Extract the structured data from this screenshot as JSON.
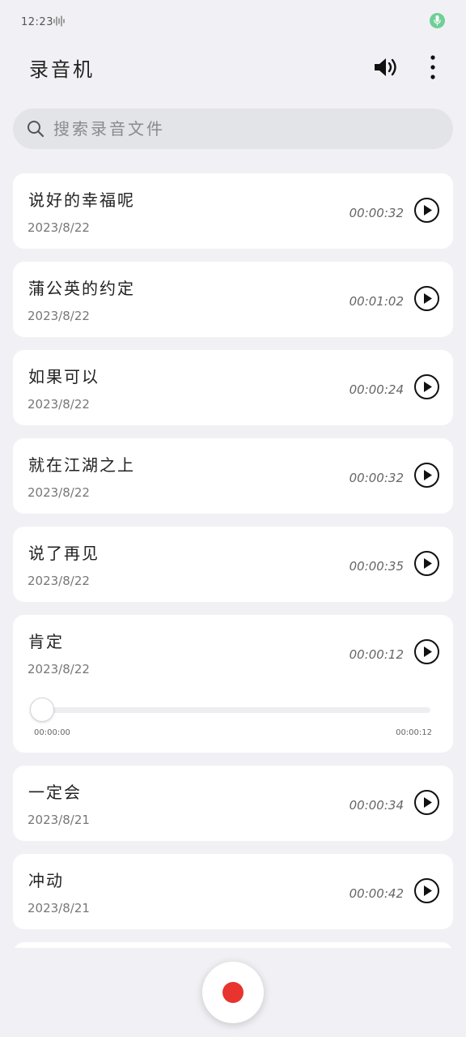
{
  "status_bar": {
    "time": "12:23"
  },
  "header": {
    "title": "录音机"
  },
  "search": {
    "placeholder": "搜索录音文件"
  },
  "recordings": [
    {
      "title": "说好的幸福呢",
      "date": "2023/8/22",
      "duration": "00:00:32"
    },
    {
      "title": "蒲公英的约定",
      "date": "2023/8/22",
      "duration": "00:01:02"
    },
    {
      "title": "如果可以",
      "date": "2023/8/22",
      "duration": "00:00:24"
    },
    {
      "title": "就在江湖之上",
      "date": "2023/8/22",
      "duration": "00:00:32"
    },
    {
      "title": "说了再见",
      "date": "2023/8/22",
      "duration": "00:00:35"
    },
    {
      "title": "肯定",
      "date": "2023/8/22",
      "duration": "00:00:12",
      "playback": {
        "current": "00:00:00",
        "total": "00:00:12",
        "progress": 0
      }
    },
    {
      "title": "一定会",
      "date": "2023/8/21",
      "duration": "00:00:34"
    },
    {
      "title": "冲动",
      "date": "2023/8/21",
      "duration": "00:00:42"
    }
  ],
  "colors": {
    "background": "#f1f1f5",
    "record_accent": "#e8332e",
    "mic_indicator": "#6fcf97"
  },
  "icons": {
    "status_wave": "audio-wave-icon",
    "status_mic": "microphone-icon",
    "speaker": "speaker-icon",
    "more": "more-vertical-icon",
    "search": "search-icon",
    "play": "play-icon",
    "record": "record-icon"
  }
}
